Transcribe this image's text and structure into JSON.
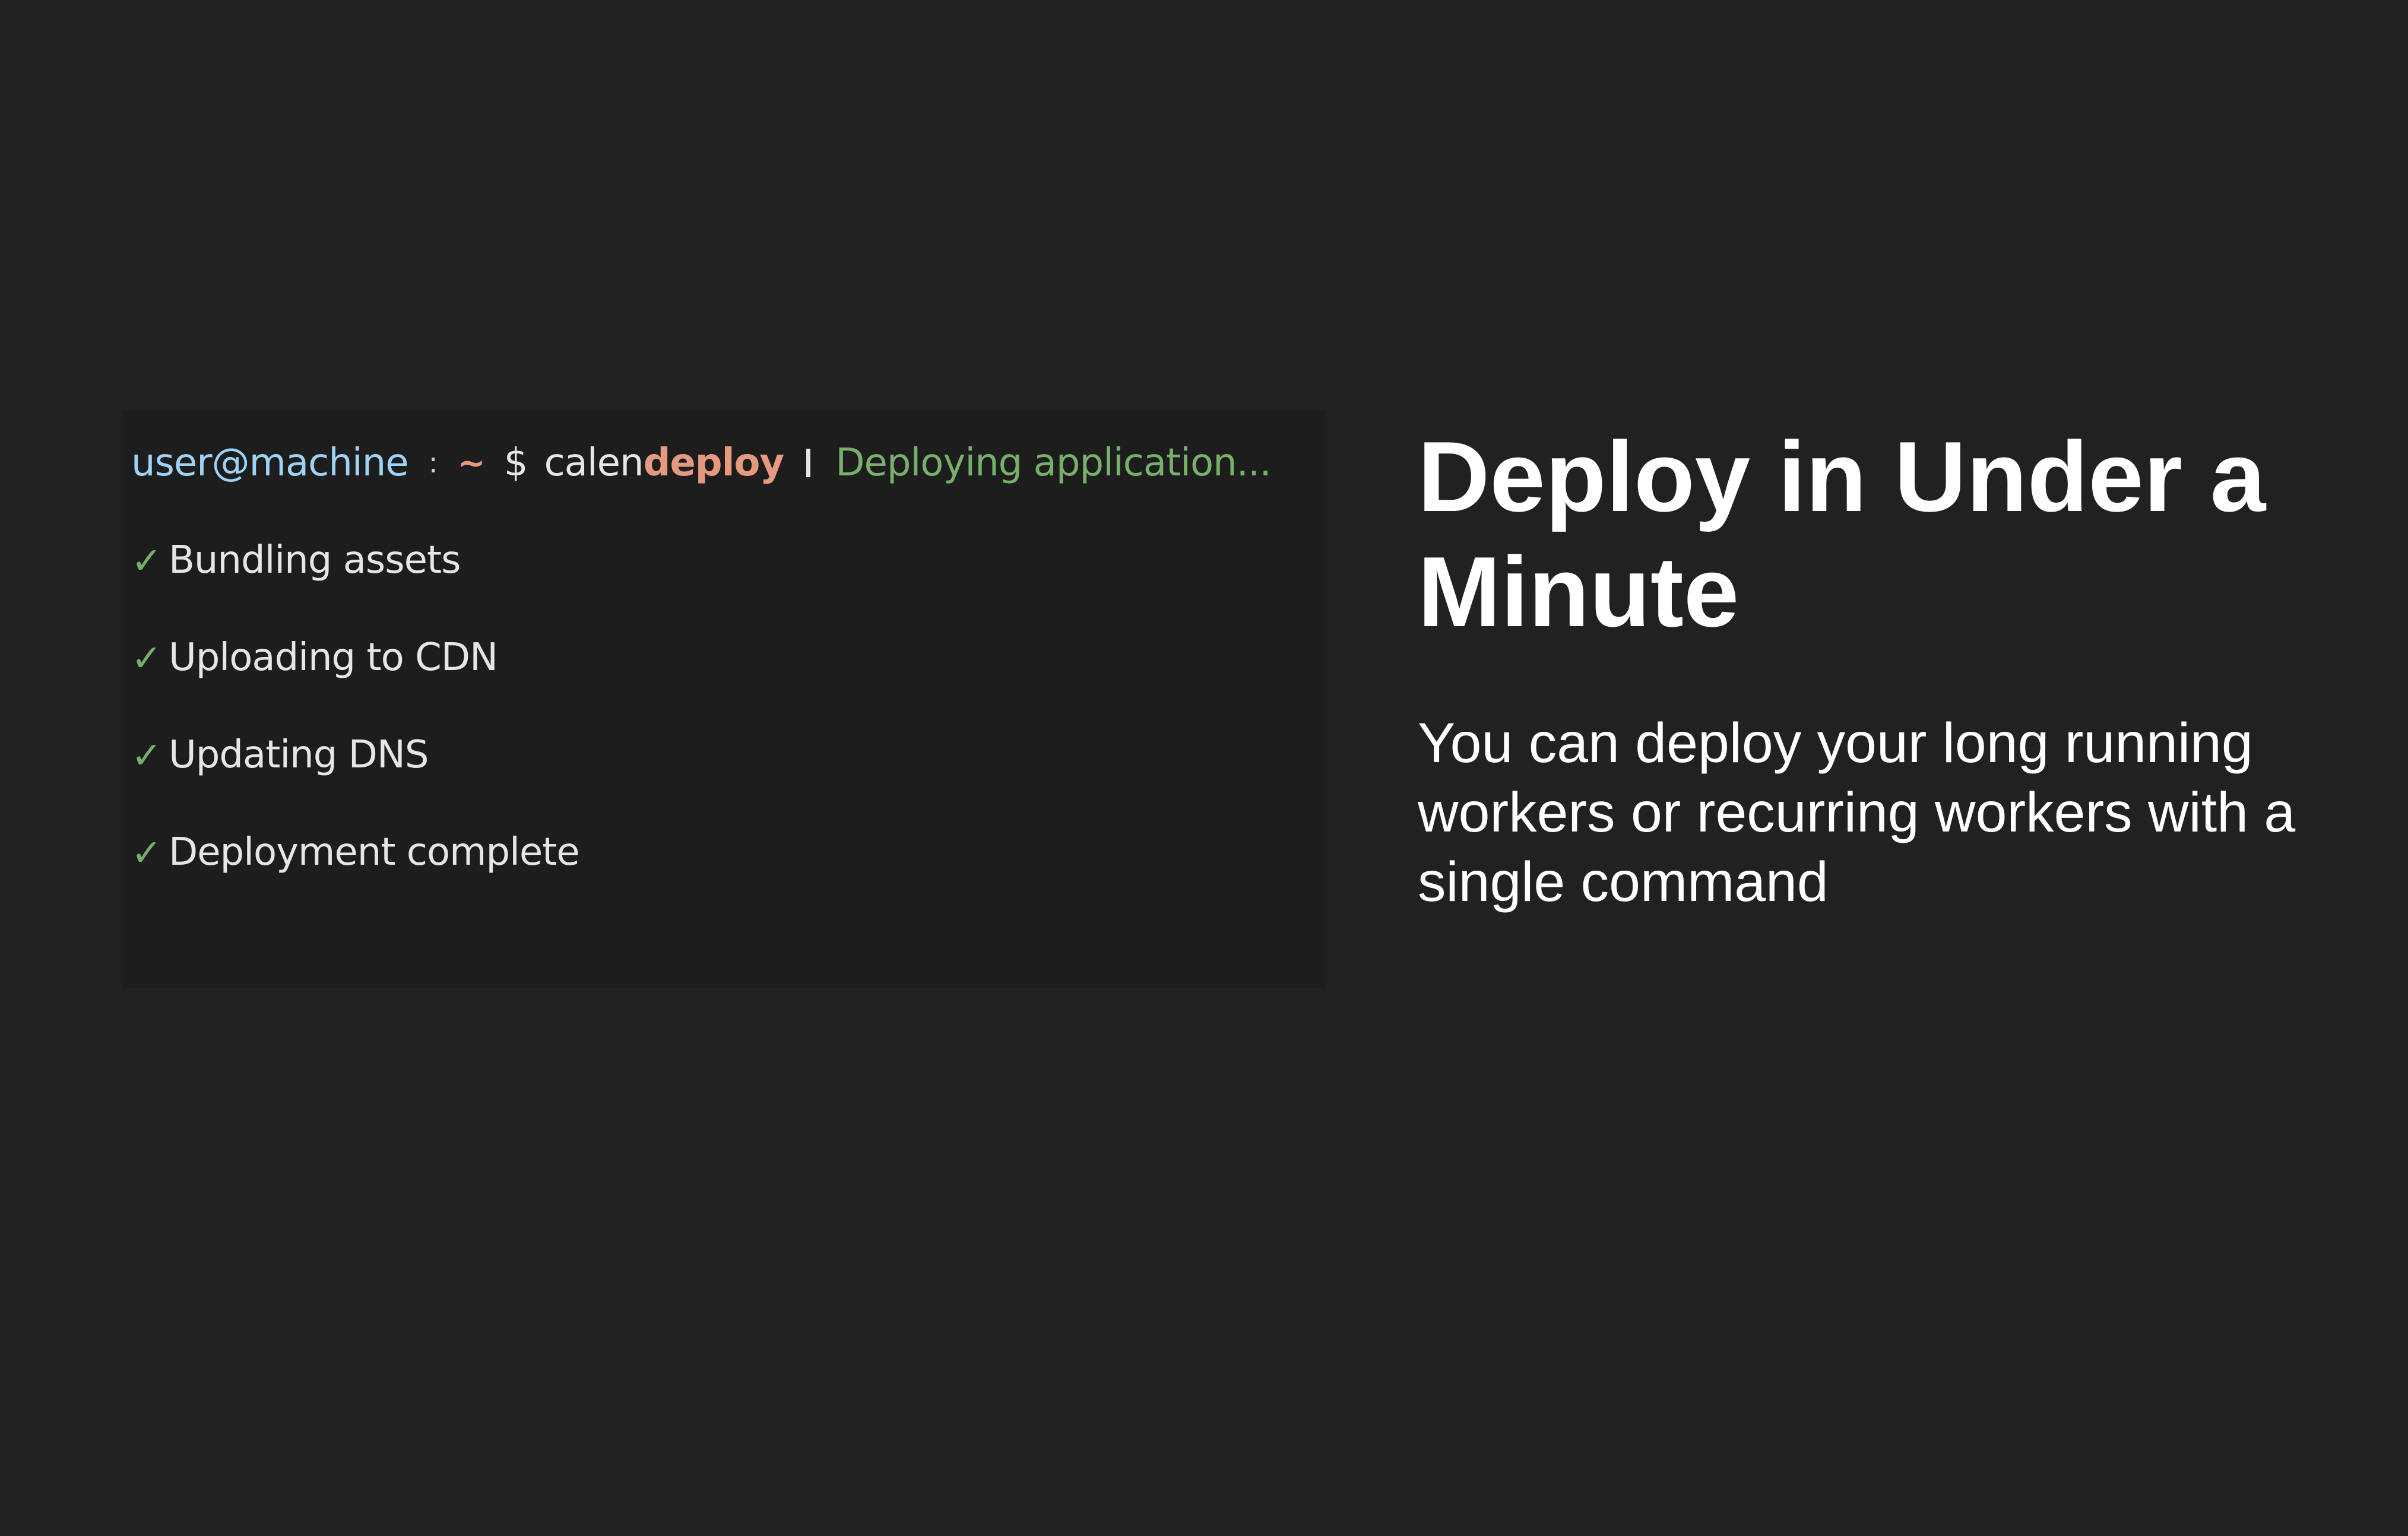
{
  "terminal": {
    "prompt": {
      "user": "user@machine",
      "colon": ":",
      "tilde": "~",
      "dollar": "$",
      "command_prefix": "calen",
      "command_suffix": "deploy",
      "status": "Deploying application..."
    },
    "check_icon": "✓",
    "steps": [
      {
        "label": "Bundling assets"
      },
      {
        "label": "Uploading to CDN"
      },
      {
        "label": "Updating DNS"
      },
      {
        "label": "Deployment complete"
      }
    ]
  },
  "info": {
    "heading": "Deploy in Under a Minute",
    "description": "You can deploy your long running workers or recurring workers with a single command"
  },
  "colors": {
    "background": "#212123",
    "terminal_bg": "#1d1d1d",
    "user": "#9ed3f5",
    "accent_orange": "#e59a7f",
    "success_green": "#77b06a",
    "text": "#e6e6e6"
  }
}
